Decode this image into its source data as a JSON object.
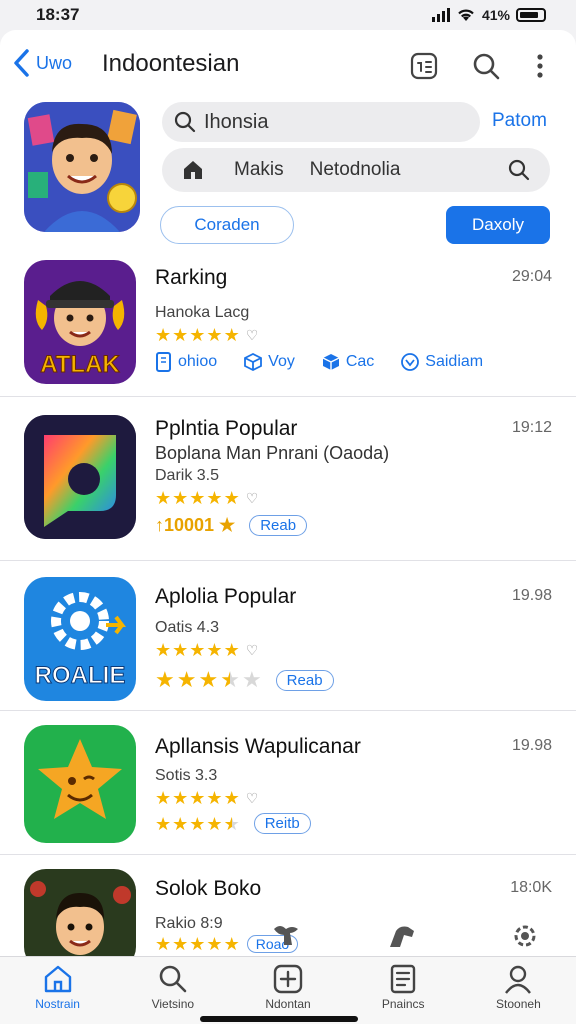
{
  "status": {
    "time": "18:37",
    "battery": "41%"
  },
  "nav": {
    "back_label": "Uwo",
    "title": "Indoontesian"
  },
  "search": {
    "value": "Ihonsia",
    "action": "Patom"
  },
  "chips": [
    "Makis",
    "Netodnolia"
  ],
  "buttons": {
    "outline": "Coraden",
    "primary": "Daxoly"
  },
  "apps": [
    {
      "name": "Rarking",
      "time": "29:04",
      "sub": "Hanoka Lacg",
      "stars": [
        1,
        1,
        1,
        1,
        1
      ],
      "icon_text": "ATLAK",
      "actions": [
        {
          "label": "ohioo",
          "icon": "document-icon"
        },
        {
          "label": "Voy",
          "icon": "box-icon"
        },
        {
          "label": "Cac",
          "icon": "cube-icon"
        },
        {
          "label": "Saidiam",
          "icon": "shield-icon"
        }
      ]
    },
    {
      "name": "Pplntia Popular",
      "time": "19:12",
      "sub2": "Boplana Man Pnrani (Oaoda)",
      "sub": "Darik 3.5",
      "stars": [
        1,
        1,
        1,
        1,
        1
      ],
      "rank": "↑10001 ★",
      "pill": "Reab"
    },
    {
      "name": "Aplolia Popular",
      "time": "19.98",
      "sub": "Oatis 4.3",
      "stars": [
        1,
        1,
        1,
        1,
        1
      ],
      "stars2": [
        1,
        1,
        1,
        0.5,
        0
      ],
      "icon_text": "ROALIE",
      "pill": "Reab"
    },
    {
      "name": "Apllansis Wapulicanar",
      "time": "19.98",
      "sub": "Sotis 3.3",
      "stars": [
        1,
        1,
        1,
        1,
        1
      ],
      "stars2": [
        1,
        1,
        1,
        1,
        0.5
      ],
      "pill": "Reitb"
    },
    {
      "name": "Solok Boko",
      "time": "18:0K",
      "sub": "Rakio 8:9",
      "stars": [
        1,
        1,
        1,
        1,
        1
      ],
      "pill": "Roao"
    }
  ],
  "tabs": [
    {
      "label": "Nostrain",
      "icon": "home-icon",
      "active": true
    },
    {
      "label": "Vietsino",
      "icon": "search-icon"
    },
    {
      "label": "Ndontan",
      "icon": "plus-square-icon"
    },
    {
      "label": "Pnaincs",
      "icon": "notes-icon"
    },
    {
      "label": "Stooneh",
      "icon": "profile-icon"
    }
  ],
  "colors": {
    "accent": "#1a73e8",
    "star": "#f5b400",
    "background": "#ffffff"
  }
}
